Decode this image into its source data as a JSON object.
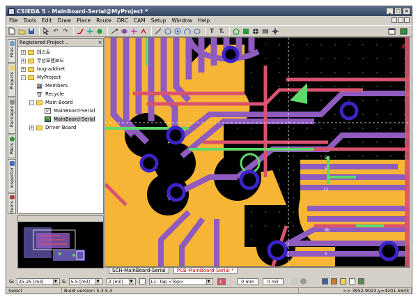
{
  "window": {
    "title": "CSIEDA 5 - MainBoard-Serial@MyProject *",
    "controls": [
      "_",
      "□",
      "×"
    ]
  },
  "menu": [
    "File",
    "Tools",
    "Edit",
    "Draw",
    "Place",
    "Route",
    "DRC",
    "CAM",
    "Setup",
    "Window",
    "Help"
  ],
  "side_tabs": [
    "Files",
    "Projects",
    "Packages",
    "PADs",
    "Inspector",
    "Items"
  ],
  "project_panel": {
    "title": "Registered Project ..",
    "tree": [
      {
        "label": "테스트",
        "level": 0,
        "expander": "+",
        "icon": "folder"
      },
      {
        "label": "무선모뎀보드",
        "level": 0,
        "expander": "+",
        "icon": "folder"
      },
      {
        "label": "bug-addnet",
        "level": 0,
        "expander": "+",
        "icon": "folder"
      },
      {
        "label": "MyProject",
        "level": 0,
        "expander": "-",
        "icon": "folder"
      },
      {
        "label": "Members",
        "level": 1,
        "expander": "",
        "icon": "members"
      },
      {
        "label": "Recycle",
        "level": 1,
        "expander": "",
        "icon": "recycle"
      },
      {
        "label": "Main Board",
        "level": 1,
        "expander": "-",
        "icon": "folder"
      },
      {
        "label": "MainBoard-Serial",
        "level": 2,
        "expander": "",
        "icon": "schematic"
      },
      {
        "label": "MainBoard-Serial",
        "level": 2,
        "expander": "",
        "icon": "pcb",
        "selected": true
      },
      {
        "label": "Driver Board",
        "level": 1,
        "expander": "+",
        "icon": "folder"
      }
    ]
  },
  "doc_tabs": [
    {
      "label": "SCH-MainBoard-Serial",
      "active": false
    },
    {
      "label": "PCB-MainBoard-Serial *",
      "active": true
    }
  ],
  "properties_bar": {
    "g_label": "G:",
    "g_value": "25.25 [mil]",
    "s_label": "S:",
    "s_value": "5.5 [mil]",
    "width_value": "2 [mil]",
    "layer_value": "L1: Top <Top>",
    "layer_number": "1",
    "x_value": "0 mm",
    "y_value": "0 mil"
  },
  "status": {
    "mode": "Select",
    "build": "Build version: 5.3.5.4",
    "coords": ">> 3952.9023,y=4201.5643"
  },
  "pcb_labels": [
    "5",
    "S",
    "12",
    "8b",
    "5"
  ],
  "colors": {
    "board_background": "#000000",
    "copper_fill": "#f6b535",
    "trace_purple": "#8f5bbf",
    "trace_pink": "#d9536e",
    "trace_green": "#5fd96a",
    "via_ring": "#3b24c6",
    "title_bar": "#3f5271"
  }
}
